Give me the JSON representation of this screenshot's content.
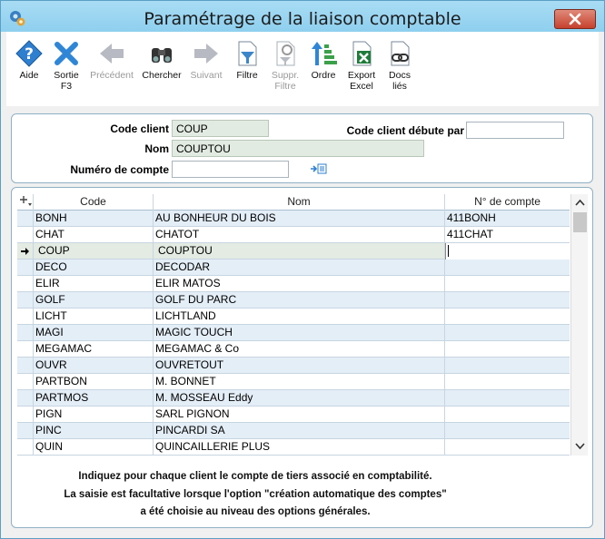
{
  "window": {
    "title": "Paramétrage de la liaison comptable"
  },
  "toolbar": {
    "aide": "Aide",
    "sortie": "Sortie",
    "sortie_key": "F3",
    "precedent": "Précédent",
    "chercher": "Chercher",
    "suivant": "Suivant",
    "filtre": "Filtre",
    "suppr": "Suppr.",
    "suppr_2": "Filtre",
    "ordre": "Ordre",
    "export": "Export",
    "export_2": "Excel",
    "docs": "Docs",
    "docs_2": "liés"
  },
  "form": {
    "code_client_label": "Code client",
    "code_client_value": "COUP",
    "nom_label": "Nom",
    "nom_value": "COUPTOU",
    "numero_label": "Numéro de compte",
    "numero_value": "",
    "debute_label": "Code client débute par",
    "debute_value": ""
  },
  "grid": {
    "headers": {
      "code": "Code",
      "nom": "Nom",
      "compte": "N° de compte"
    },
    "rows": [
      {
        "code": "BONH",
        "nom": "AU BONHEUR DU BOIS",
        "compte": "411BONH"
      },
      {
        "code": "CHAT",
        "nom": "CHATOT",
        "compte": "411CHAT"
      },
      {
        "code": "COUP",
        "nom": "COUPTOU",
        "compte": ""
      },
      {
        "code": "DECO",
        "nom": "DECODAR",
        "compte": ""
      },
      {
        "code": "ELIR",
        "nom": "ELIR MATOS",
        "compte": ""
      },
      {
        "code": "GOLF",
        "nom": "GOLF DU PARC",
        "compte": ""
      },
      {
        "code": "LICHT",
        "nom": "LICHTLAND",
        "compte": ""
      },
      {
        "code": "MAGI",
        "nom": "MAGIC TOUCH",
        "compte": ""
      },
      {
        "code": "MEGAMAC",
        "nom": "MEGAMAC & Co",
        "compte": ""
      },
      {
        "code": "OUVR",
        "nom": "OUVRETOUT",
        "compte": ""
      },
      {
        "code": "PARTBON",
        "nom": "M. BONNET",
        "compte": ""
      },
      {
        "code": "PARTMOS",
        "nom": "M. MOSSEAU Eddy",
        "compte": ""
      },
      {
        "code": "PIGN",
        "nom": "SARL PIGNON",
        "compte": ""
      },
      {
        "code": "PINC",
        "nom": "PINCARDI SA",
        "compte": ""
      },
      {
        "code": "QUIN",
        "nom": "QUINCAILLERIE PLUS",
        "compte": ""
      }
    ]
  },
  "notes": {
    "line1": "Indiquez pour chaque client le compte de tiers associé en comptabilité.",
    "line2": "La saisie est facultative lorsque l'option \"création automatique des comptes\"",
    "line3": "a été choisie au niveau des options générales."
  },
  "colors": {
    "titlebar": "#8ecfee",
    "close": "#c6412d",
    "row_alt": "#e4eef7"
  }
}
